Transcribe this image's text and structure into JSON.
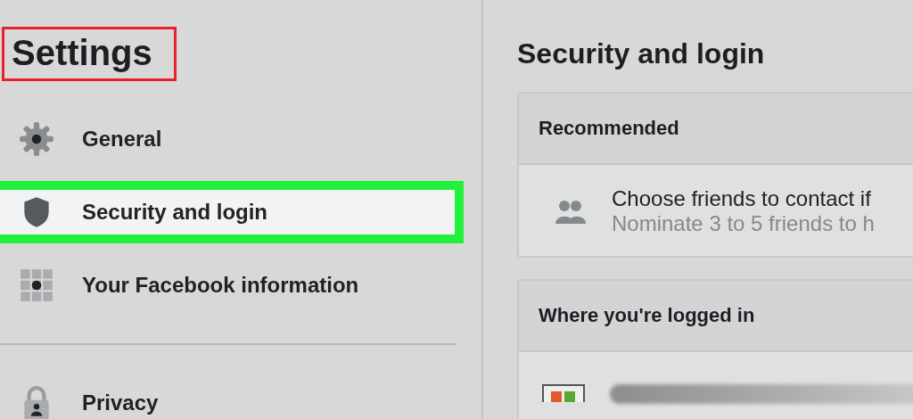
{
  "sidebar": {
    "title": "Settings",
    "title_outlined": true,
    "items": [
      {
        "label": "General",
        "selected": false,
        "highlighted": false,
        "divider_before": false
      },
      {
        "label": "Security and login",
        "selected": true,
        "highlighted": true,
        "divider_before": false
      },
      {
        "label": "Your Facebook information",
        "selected": false,
        "highlighted": false,
        "divider_before": false
      },
      {
        "label": "Privacy",
        "selected": false,
        "highlighted": false,
        "divider_before": true
      }
    ]
  },
  "main": {
    "title": "Security and login",
    "sections": [
      {
        "heading": "Recommended",
        "rows": [
          {
            "kind": "suggestion",
            "title": "Choose friends to contact if",
            "subtitle": "Nominate 3 to 5 friends to h"
          }
        ]
      },
      {
        "heading": "Where you're logged in",
        "rows": [
          {
            "kind": "device"
          }
        ]
      }
    ]
  }
}
